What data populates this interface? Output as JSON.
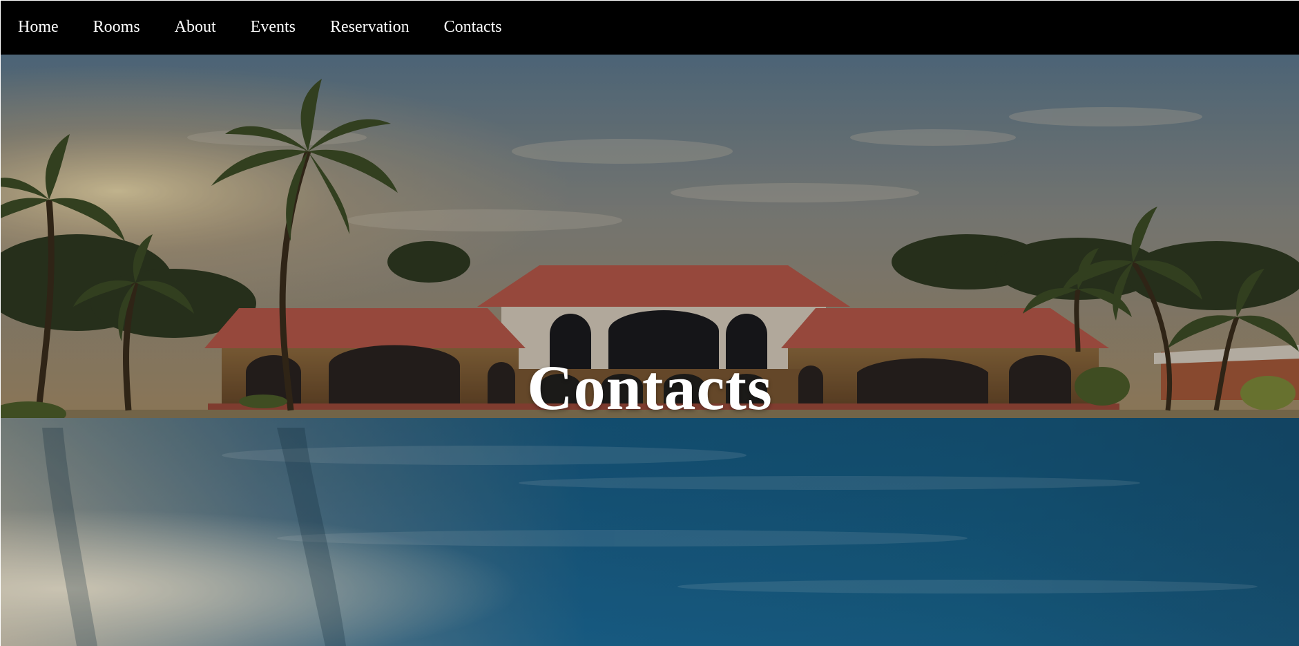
{
  "nav": {
    "items": [
      {
        "label": "Home"
      },
      {
        "label": "Rooms"
      },
      {
        "label": "About"
      },
      {
        "label": "Events"
      },
      {
        "label": "Reservation"
      },
      {
        "label": "Contacts"
      }
    ]
  },
  "hero": {
    "title": "Contacts",
    "background_image": "resort-pool-photo"
  },
  "colors": {
    "nav_bg": "#000000",
    "nav_text": "#ffffff",
    "title_text": "#ffffff",
    "pool": "#1f6f9a",
    "roof": "#b8584a"
  }
}
